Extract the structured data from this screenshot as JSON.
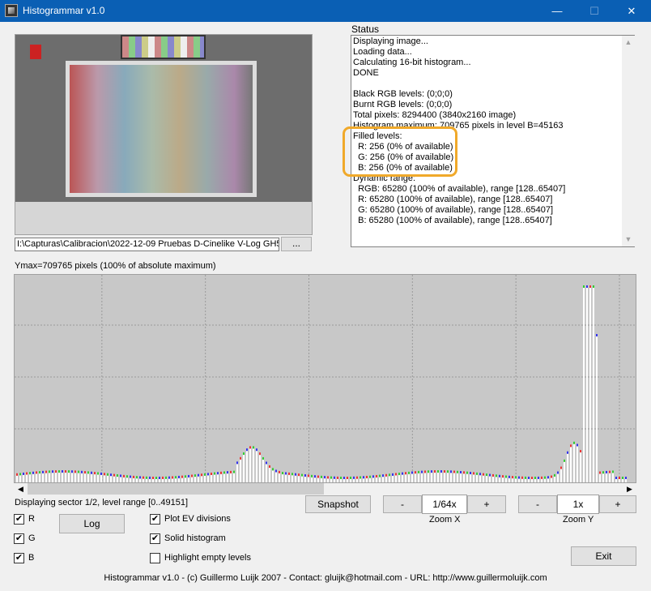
{
  "window": {
    "title": "Histogrammar v1.0",
    "minimize_glyph": "—",
    "maximize_glyph": "☐",
    "close_glyph": "✕"
  },
  "path_field": {
    "value": "I:\\Capturas\\Calibracion\\2022-12-09 Pruebas D-Cinelike V-Log GH5\\",
    "browse_label": "..."
  },
  "status": {
    "label": "Status",
    "lines": [
      "Displaying image...",
      "Loading data...",
      "Calculating 16-bit histogram...",
      "DONE",
      "",
      "Black RGB levels: (0;0;0)",
      "Burnt RGB levels: (0;0;0)",
      "Total pixels: 8294400 (3840x2160 image)",
      "Histogram maximum: 709765 pixels in level B=45163",
      "Filled levels:",
      "  R: 256 (0% of available)",
      "  G: 256 (0% of available)",
      "  B: 256 (0% of available)",
      "Dynamic range:",
      "  RGB: 65280 (100% of available), range [128..65407]",
      "  R: 65280 (100% of available), range [128..65407]",
      "  G: 65280 (100% of available), range [128..65407]",
      "  B: 65280 (100% of available), range [128..65407]"
    ],
    "scroll_up": "▲",
    "scroll_down": "▼"
  },
  "histogram": {
    "ymax_label": "Ymax=709765 pixels (100% of absolute maximum)",
    "sector_label": "Displaying sector 1/2, level range [0..49151]",
    "scroll_left": "◀",
    "scroll_right": "▶",
    "background": "#c8c8c8",
    "grid_color": "#9a9a9a"
  },
  "controls": {
    "checkboxes": {
      "r": {
        "label": "R",
        "checked": true
      },
      "g": {
        "label": "G",
        "checked": true
      },
      "b": {
        "label": "B",
        "checked": true
      },
      "plot_ev": {
        "label": "Plot EV divisions",
        "checked": true
      },
      "solid": {
        "label": "Solid histogram",
        "checked": true
      },
      "highlight_empty": {
        "label": "Highlight empty levels",
        "checked": false
      }
    },
    "log_label": "Log",
    "snapshot_label": "Snapshot",
    "zoom_x": {
      "minus": "-",
      "value": "1/64x",
      "plus": "+",
      "label": "Zoom X"
    },
    "zoom_y": {
      "minus": "-",
      "value": "1x",
      "plus": "+",
      "label": "Zoom Y"
    },
    "exit_label": "Exit"
  },
  "footer": "Histogrammar v1.0 - (c) Guillermo Luijk 2007 - Contact: gluijk@hotmail.com - URL: http://www.guillermoluijk.com",
  "colors": {
    "titlebar": "#0a5fb4",
    "highlight": "#f0a92a"
  }
}
